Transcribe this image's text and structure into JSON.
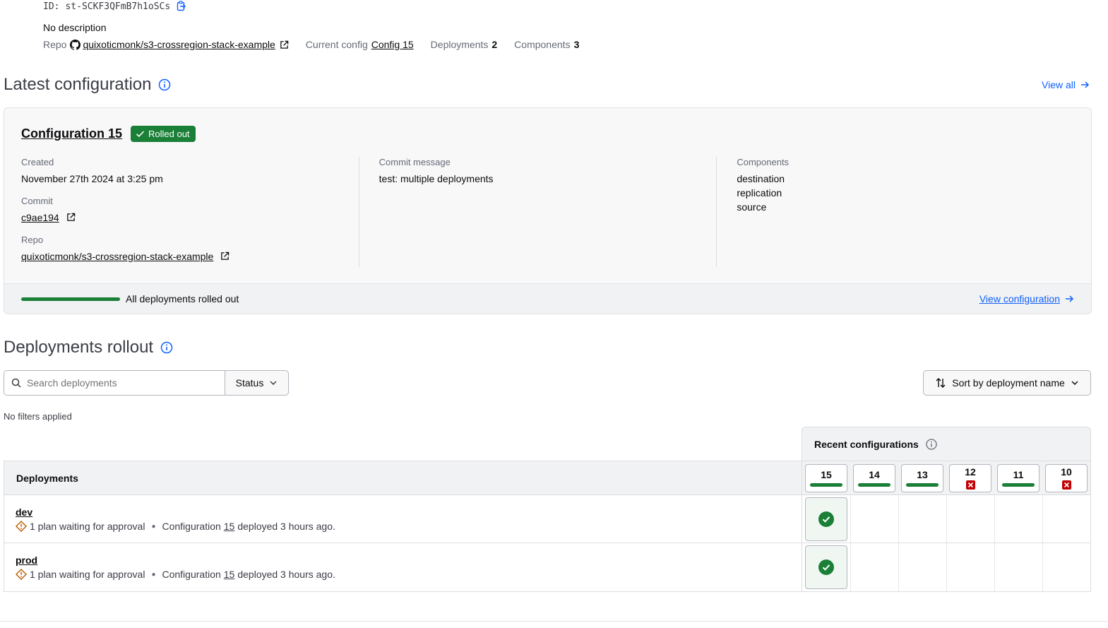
{
  "stack": {
    "id_label": "ID:",
    "id_value": "st-SCKF3QFmB7h1oSCs",
    "description": "No description",
    "repo_label": "Repo",
    "repo_value": "quixoticmonk/s3-crossregion-stack-example",
    "current_config_label": "Current config",
    "current_config_value": "Config 15",
    "deployments_label": "Deployments",
    "deployments_value": "2",
    "components_label": "Components",
    "components_value": "3"
  },
  "latest": {
    "title": "Latest configuration",
    "view_all": "View all",
    "config_title": "Configuration 15",
    "badge": "Rolled out",
    "created_label": "Created",
    "created_value": "November 27th 2024 at 3:25 pm",
    "commit_label": "Commit",
    "commit_value": "c9ae194",
    "repo_label": "Repo",
    "repo_value": "quixoticmonk/s3-crossregion-stack-example",
    "commit_message_label": "Commit message",
    "commit_message_value": "test: multiple deployments",
    "components_label": "Components",
    "components": [
      "destination",
      "replication",
      "source"
    ],
    "progress_fraction": 1.0,
    "footer_text": "All deployments rolled out",
    "view_configuration": "View configuration"
  },
  "rollout": {
    "title": "Deployments rollout",
    "search_placeholder": "Search deployments",
    "status_filter": "Status",
    "sort": "Sort by deployment name",
    "filters_text": "No filters applied",
    "recent_label": "Recent configurations",
    "deployments_header": "Deployments",
    "configs": [
      {
        "num": "15",
        "state": "success"
      },
      {
        "num": "14",
        "state": "success"
      },
      {
        "num": "13",
        "state": "success"
      },
      {
        "num": "12",
        "state": "failed"
      },
      {
        "num": "11",
        "state": "success"
      },
      {
        "num": "10",
        "state": "failed"
      }
    ],
    "deployments": [
      {
        "name": "dev",
        "plan_text": "1 plan waiting for approval",
        "config_prefix": "Configuration",
        "config_num": "15",
        "config_suffix": "deployed 3 hours ago."
      },
      {
        "name": "prod",
        "plan_text": "1 plan waiting for approval",
        "config_prefix": "Configuration",
        "config_num": "15",
        "config_suffix": "deployed 3 hours ago."
      }
    ]
  },
  "colors": {
    "success": "#1a7f37",
    "failed": "#c00005",
    "link": "#1060ff",
    "warning": "#bb5a00"
  }
}
